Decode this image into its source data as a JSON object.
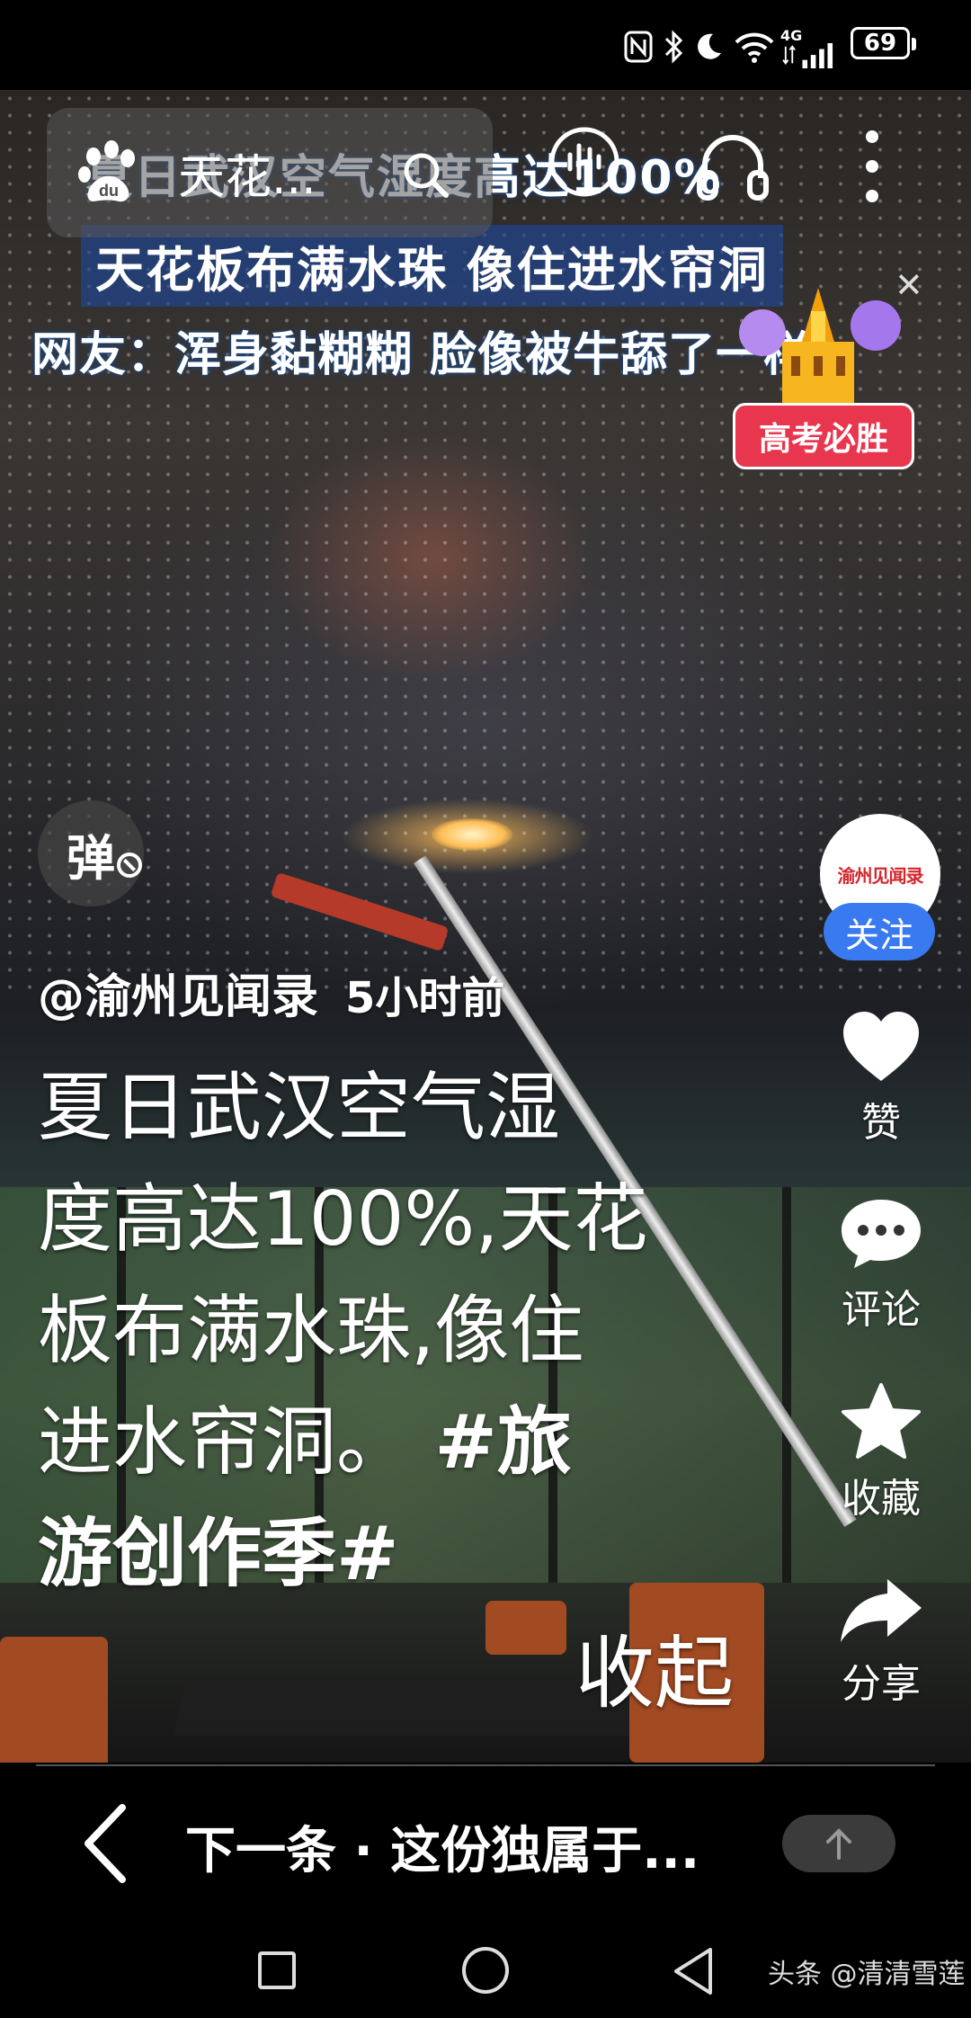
{
  "status_bar": {
    "time": "",
    "battery": "69",
    "network": "4G",
    "icons": [
      "nfc-icon",
      "bluetooth-icon",
      "moon-icon",
      "wifi-icon",
      "signal-icon",
      "battery-icon"
    ]
  },
  "search": {
    "text": "天花..."
  },
  "video_captions": {
    "line1": "夏日武汉空气湿度高达100%",
    "line2": "天花板布满水珠 像住进水帘洞",
    "line3": "网友：浑身黏糊糊 脸像被牛舔了一样"
  },
  "promo": {
    "badge": "高考必胜"
  },
  "danmu": {
    "label": "弹"
  },
  "author": {
    "handle": "@渝州见闻录",
    "time": "5小时前",
    "avatar_text": "渝州见闻录"
  },
  "rail": {
    "follow": "关注",
    "like": "赞",
    "comment": "评论",
    "favorite": "收藏",
    "share": "分享"
  },
  "description": {
    "lines": [
      "夏日武汉空气湿",
      "度高达100%,天花",
      "板布满水珠,像住",
      "进水帘洞。 "
    ],
    "tag_part1": "#旅",
    "tag_part2": "游创作季#",
    "collapse": "收起"
  },
  "next_bar": {
    "title": "下一条 · 这份独属于..."
  },
  "watermark": "头条 @清清雪莲",
  "colors": {
    "follow_blue": "#3a7af0",
    "badge_red": "#e8364e"
  }
}
